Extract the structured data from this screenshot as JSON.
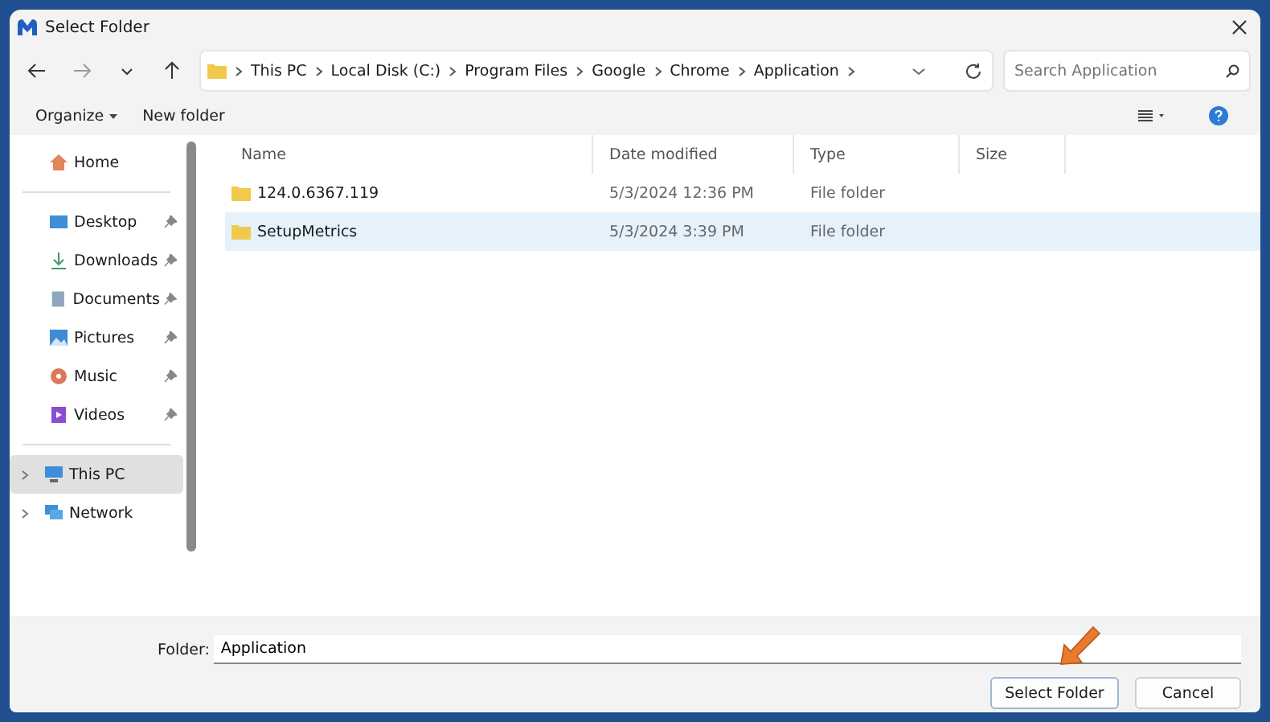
{
  "window": {
    "title": "Select Folder"
  },
  "breadcrumb": [
    "This PC",
    "Local Disk (C:)",
    "Program Files",
    "Google",
    "Chrome",
    "Application"
  ],
  "search": {
    "placeholder": "Search Application"
  },
  "toolbar": {
    "organize": "Organize",
    "new_folder": "New folder"
  },
  "sidebar": {
    "sections": [
      [
        {
          "label": "Home",
          "kind": "home",
          "pinned": false,
          "expandable": false,
          "selected": false
        }
      ],
      [
        {
          "label": "Desktop",
          "kind": "desktop",
          "pinned": true,
          "expandable": false,
          "selected": false
        },
        {
          "label": "Downloads",
          "kind": "downloads",
          "pinned": true,
          "expandable": false,
          "selected": false
        },
        {
          "label": "Documents",
          "kind": "documents",
          "pinned": true,
          "expandable": false,
          "selected": false
        },
        {
          "label": "Pictures",
          "kind": "pictures",
          "pinned": true,
          "expandable": false,
          "selected": false
        },
        {
          "label": "Music",
          "kind": "music",
          "pinned": true,
          "expandable": false,
          "selected": false
        },
        {
          "label": "Videos",
          "kind": "videos",
          "pinned": true,
          "expandable": false,
          "selected": false
        }
      ],
      [
        {
          "label": "This PC",
          "kind": "pc",
          "pinned": false,
          "expandable": true,
          "selected": true
        },
        {
          "label": "Network",
          "kind": "network",
          "pinned": false,
          "expandable": true,
          "selected": false
        }
      ]
    ]
  },
  "table": {
    "columns": [
      "Name",
      "Date modified",
      "Type",
      "Size"
    ],
    "rows": [
      {
        "name": "124.0.6367.119",
        "date": "5/3/2024 12:36 PM",
        "type": "File folder",
        "selected": false
      },
      {
        "name": "SetupMetrics",
        "date": "5/3/2024 3:39 PM",
        "type": "File folder",
        "selected": true
      }
    ]
  },
  "folder": {
    "label": "Folder:",
    "value": "Application"
  },
  "buttons": [
    {
      "label": "Select Folder",
      "primary": true
    },
    {
      "label": "Cancel",
      "primary": false
    }
  ]
}
